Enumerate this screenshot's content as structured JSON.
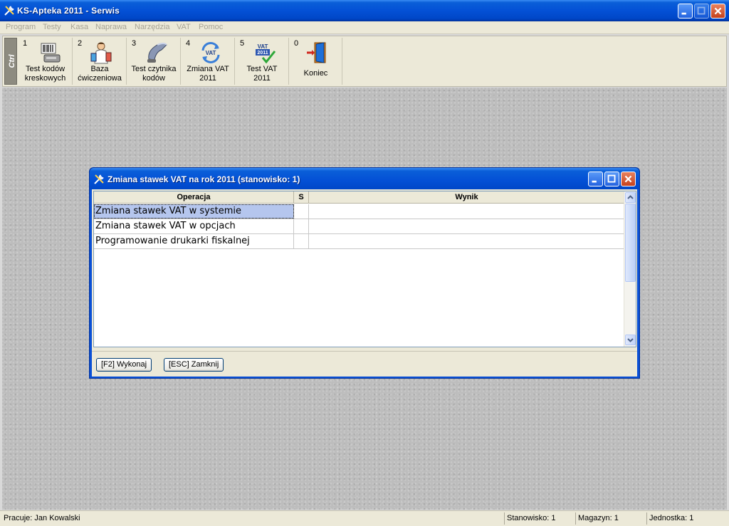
{
  "window": {
    "title": "KS-Apteka 2011 - Serwis"
  },
  "menu": [
    "Program",
    "Testy",
    "Kasa",
    "Naprawa",
    "Narzędzia",
    "VAT",
    "Pomoc"
  ],
  "toolbar": {
    "ctrl_label": "Ctrl",
    "tools": [
      {
        "hotkey": "1",
        "label": "Test kodów\nkreskowych",
        "icon": "barcode-scanner-icon"
      },
      {
        "hotkey": "2",
        "label": "Baza\nćwiczeniowa",
        "icon": "database-scientist-icon"
      },
      {
        "hotkey": "3",
        "label": "Test czytnika\nkodów",
        "icon": "barcode-reader-icon"
      },
      {
        "hotkey": "4",
        "label": "Zmiana VAT\n2011",
        "icon": "vat-change-icon"
      },
      {
        "hotkey": "5",
        "label": "Test VAT\n2011",
        "icon": "vat-test-icon"
      },
      {
        "hotkey": "0",
        "label": "Koniec",
        "icon": "exit-door-icon"
      }
    ]
  },
  "dialog": {
    "title": "Zmiana stawek VAT na rok 2011 (stanowisko: 1)",
    "columns": [
      "Operacja",
      "S",
      "Wynik"
    ],
    "rows": [
      {
        "operacja": "Zmiana stawek VAT w systemie",
        "s": "",
        "wynik": ""
      },
      {
        "operacja": "Zmiana stawek VAT w opcjach",
        "s": "",
        "wynik": ""
      },
      {
        "operacja": "Programowanie drukarki fiskalnej",
        "s": "",
        "wynik": ""
      }
    ],
    "buttons": {
      "execute": "[F2] Wykonaj",
      "close": "[ESC] Zamknij"
    }
  },
  "status": {
    "user": "Pracuje: Jan Kowalski",
    "station": "Stanowisko: 1",
    "warehouse": "Magazyn: 1",
    "unit": "Jednostka: 1"
  },
  "colors": {
    "titlebar": "#0451d6",
    "selection": "#b5c6ee",
    "close_button": "#c5411c"
  }
}
